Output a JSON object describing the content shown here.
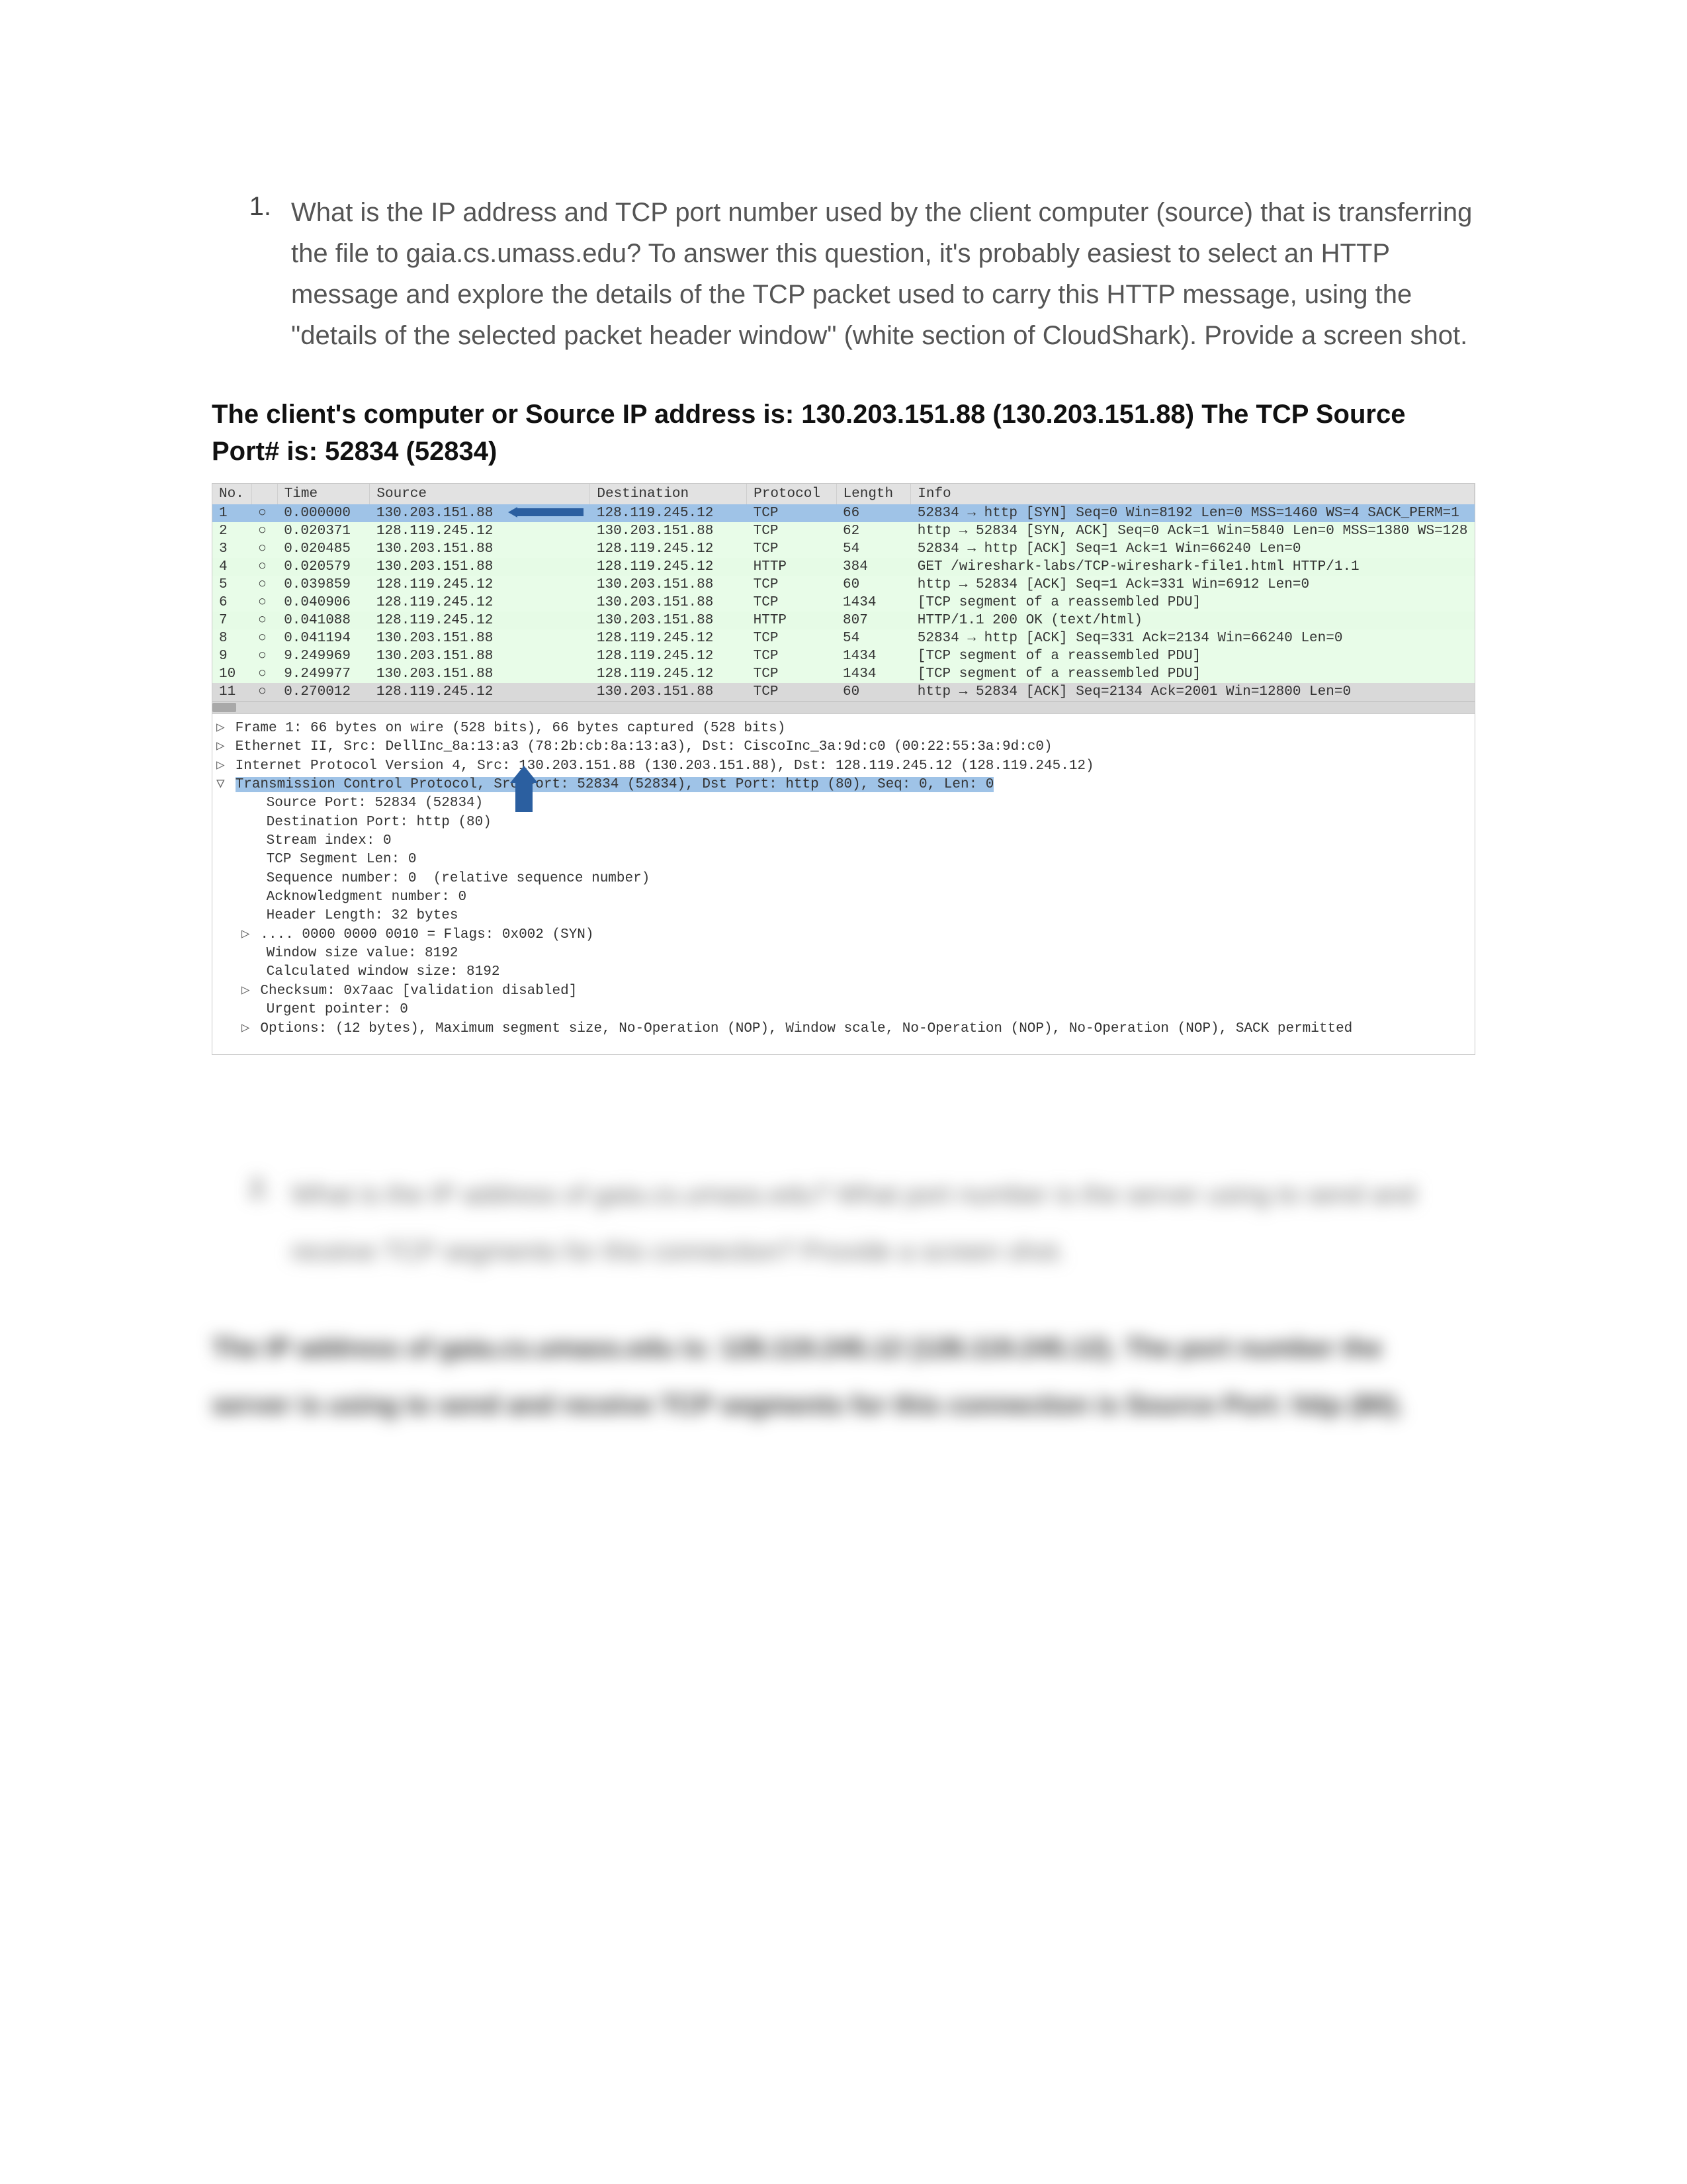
{
  "question1": {
    "number": "1.",
    "text": "What is the IP address and TCP port number used by the client computer (source) that is transferring the file to gaia.cs.umass.edu? To answer this question, it's probably easiest to select an HTTP message and explore the details of the TCP packet used to carry this HTTP message, using the \"details of the selected packet header window\" (white section of CloudShark). Provide a screen shot."
  },
  "answer1": "The client's computer or Source IP address is: 130.203.151.88 (130.203.151.88) The TCP Source Port# is: 52834 (52834)",
  "table_headers": [
    "No.",
    " ",
    "Time",
    "Source",
    "Destination",
    "Protocol",
    "Length",
    "Info"
  ],
  "packets": [
    {
      "no": "1",
      "mark": "○",
      "time": "0.000000",
      "src": "130.203.151.88",
      "dst": "128.119.245.12",
      "proto": "TCP",
      "len": "66",
      "info": "52834 → http [SYN] Seq=0 Win=8192 Len=0 MSS=1460 WS=4 SACK_PERM=1",
      "cls": "row-sel"
    },
    {
      "no": "2",
      "mark": "○",
      "time": "0.020371",
      "src": "128.119.245.12",
      "dst": "130.203.151.88",
      "proto": "TCP",
      "len": "62",
      "info": "http → 52834 [SYN, ACK] Seq=0 Ack=1 Win=5840 Len=0 MSS=1380 WS=128",
      "cls": "proto-TCP"
    },
    {
      "no": "3",
      "mark": "○",
      "time": "0.020485",
      "src": "130.203.151.88",
      "dst": "128.119.245.12",
      "proto": "TCP",
      "len": "54",
      "info": "52834 → http [ACK] Seq=1 Ack=1 Win=66240 Len=0",
      "cls": "proto-TCP"
    },
    {
      "no": "4",
      "mark": "○",
      "time": "0.020579",
      "src": "130.203.151.88",
      "dst": "128.119.245.12",
      "proto": "HTTP",
      "len": "384",
      "info": "GET /wireshark-labs/TCP-wireshark-file1.html HTTP/1.1",
      "cls": "proto-HTTP"
    },
    {
      "no": "5",
      "mark": "○",
      "time": "0.039859",
      "src": "128.119.245.12",
      "dst": "130.203.151.88",
      "proto": "TCP",
      "len": "60",
      "info": "http → 52834 [ACK] Seq=1 Ack=331 Win=6912 Len=0",
      "cls": "proto-TCP"
    },
    {
      "no": "6",
      "mark": "○",
      "time": "0.040906",
      "src": "128.119.245.12",
      "dst": "130.203.151.88",
      "proto": "TCP",
      "len": "1434",
      "info": "[TCP segment of a reassembled PDU]",
      "cls": "proto-TCP"
    },
    {
      "no": "7",
      "mark": "○",
      "time": "0.041088",
      "src": "128.119.245.12",
      "dst": "130.203.151.88",
      "proto": "HTTP",
      "len": "807",
      "info": "HTTP/1.1 200 OK (text/html)",
      "cls": "proto-HTTP"
    },
    {
      "no": "8",
      "mark": "○",
      "time": "0.041194",
      "src": "130.203.151.88",
      "dst": "128.119.245.12",
      "proto": "TCP",
      "len": "54",
      "info": "52834 → http [ACK] Seq=331 Ack=2134 Win=66240 Len=0",
      "cls": "proto-TCP"
    },
    {
      "no": "9",
      "mark": "○",
      "time": "9.249969",
      "src": "130.203.151.88",
      "dst": "128.119.245.12",
      "proto": "TCP",
      "len": "1434",
      "info": "[TCP segment of a reassembled PDU]",
      "cls": "proto-TCP"
    },
    {
      "no": "10",
      "mark": "○",
      "time": "9.249977",
      "src": "130.203.151.88",
      "dst": "128.119.245.12",
      "proto": "TCP",
      "len": "1434",
      "info": "[TCP segment of a reassembled PDU]",
      "cls": "proto-TCP"
    },
    {
      "no": "11",
      "mark": "○",
      "time": "0.270012",
      "src": "128.119.245.12",
      "dst": "130.203.151.88",
      "proto": "TCP",
      "len": "60",
      "info": "http → 52834 [ACK] Seq=2134 Ack=2001 Win=12800 Len=0",
      "cls": "row-last"
    }
  ],
  "details": {
    "l1": "Frame 1: 66 bytes on wire (528 bits), 66 bytes captured (528 bits)",
    "l2": "Ethernet II, Src: DellInc_8a:13:a3 (78:2b:cb:8a:13:a3), Dst: CiscoInc_3a:9d:c0 (00:22:55:3a:9d:c0)",
    "l3": "Internet Protocol Version 4, Src: 130.203.151.88 (130.203.151.88), Dst: 128.119.245.12 (128.119.245.12)",
    "l4": "Transmission Control Protocol, Src Port: 52834 (52834), Dst Port: http (80), Seq: 0, Len: 0",
    "indent": [
      "Source Port: 52834 (52834)",
      "Destination Port: http (80)",
      "Stream index: 0",
      "TCP Segment Len: 0",
      "Sequence number: 0  (relative sequence number)",
      "Acknowledgment number: 0",
      "Header Length: 32 bytes",
      ".... 0000 0000 0010 = Flags: 0x002 (SYN)",
      "Window size value: 8192",
      "Calculated window size: 8192",
      "Checksum: 0x7aac [validation disabled]",
      "Urgent pointer: 0",
      "Options: (12 bytes), Maximum segment size, No-Operation (NOP), Window scale, No-Operation (NOP), No-Operation (NOP), SACK permitted"
    ]
  },
  "question2": {
    "number": "2.",
    "line1": "What is the IP address of gaia.cs.umass.edu? What port number is the server using to send and",
    "line2": "receive TCP segments for this connection? Provide a screen shot.",
    "ans1": "The IP address of gaia.cs.umass.edu is: 128.119.245.12 (128.119.245.12). The port number the",
    "ans2": "server is using to send and receive TCP segments for this connection is Source Port: http (80)."
  }
}
